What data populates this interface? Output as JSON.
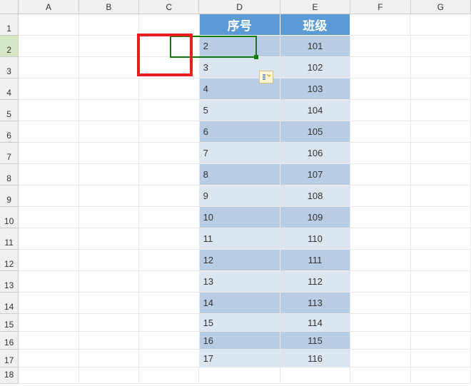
{
  "columns": [
    "A",
    "B",
    "C",
    "D",
    "E",
    "F",
    "G"
  ],
  "rowCount": 18,
  "selectedRow": 2,
  "table": {
    "headers": {
      "d": "序号",
      "e": "班级"
    }
  },
  "chart_data": {
    "type": "table",
    "title": "",
    "columns": [
      "序号",
      "班级"
    ],
    "rows": [
      [
        2,
        101
      ],
      [
        3,
        102
      ],
      [
        4,
        103
      ],
      [
        5,
        104
      ],
      [
        6,
        105
      ],
      [
        7,
        106
      ],
      [
        8,
        107
      ],
      [
        9,
        108
      ],
      [
        10,
        109
      ],
      [
        11,
        110
      ],
      [
        12,
        111
      ],
      [
        13,
        112
      ],
      [
        14,
        113
      ],
      [
        15,
        114
      ],
      [
        16,
        115
      ],
      [
        17,
        116
      ]
    ]
  }
}
